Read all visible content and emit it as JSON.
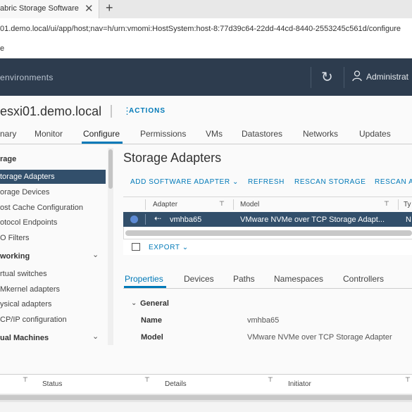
{
  "browser": {
    "tab_title": "abric Storage Software",
    "tab_close": "✕",
    "new_tab": "+",
    "url": "01.demo.local/ui/app/host;nav=h/urn:vmomi:HostSystem:host-8:77d39c64-22dd-44cd-8440-2553245c561d/configure",
    "bookmark": "e"
  },
  "vsphere": {
    "title": "environments",
    "refresh_icon": "↻",
    "user_label": "Administrat"
  },
  "host": {
    "name": "esxi01.demo.local",
    "actions_icon": "⋮",
    "actions": "ACTIONS"
  },
  "nav_tabs": [
    "nary",
    "Monitor",
    "Configure",
    "Permissions",
    "VMs",
    "Datastores",
    "Networks",
    "Updates"
  ],
  "sidebar": {
    "storage_section": "rage",
    "storage_items": [
      "torage Adapters",
      "orage Devices",
      "ost Cache Configuration",
      "otocol Endpoints",
      "O Filters"
    ],
    "networking_section": "working",
    "networking_items": [
      "rtual switches",
      "Mkernel adapters",
      "ysical adapters",
      "CP/IP configuration"
    ],
    "vm_section": "ual Machines",
    "chevron": "⌄"
  },
  "content": {
    "title": "Storage Adapters",
    "toolbar": {
      "add_software_adapter": "ADD SOFTWARE ADAPTER ⌄",
      "refresh": "REFRESH",
      "rescan_storage": "RESCAN STORAGE",
      "rescan_adapter": "RESCAN A"
    },
    "grid": {
      "columns": [
        "Adapter",
        "Model",
        "Ty"
      ],
      "filter_icon": "⊤",
      "rows": [
        {
          "adapter": "vmhba65",
          "model": "VMware NVMe over TCP Storage Adapt...",
          "type": "N",
          "icon": "⇠"
        }
      ],
      "export": "EXPORT ⌄"
    },
    "detail_tabs": [
      "Properties",
      "Devices",
      "Paths",
      "Namespaces",
      "Controllers"
    ],
    "general": {
      "chevron": "⌄",
      "label": "General",
      "name_label": "Name",
      "name_value": "vmhba65",
      "model_label": "Model",
      "model_value": "VMware NVMe over TCP Storage Adapter"
    }
  },
  "bottom": {
    "columns": [
      "Status",
      "Details",
      "Initiator"
    ],
    "filter_icon": "⊤"
  }
}
